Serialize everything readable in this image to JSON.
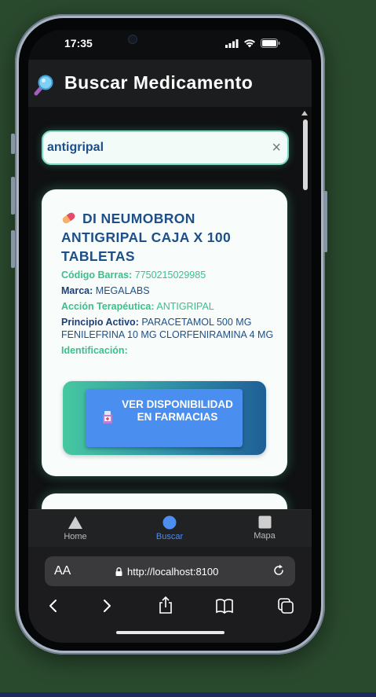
{
  "status_bar": {
    "time": "17:35"
  },
  "header": {
    "title": "Buscar Medicamento",
    "icon": "magnifier-icon"
  },
  "search": {
    "value": "antigripal",
    "clear_label": "×"
  },
  "result": {
    "title": "DI NEUMOBRON ANTIGRIPAL CAJA X 100 TABLETAS",
    "fields": [
      {
        "label": "Código Barras:",
        "value": "7750215029985"
      },
      {
        "label": "Marca:",
        "value": "MEGALABS"
      },
      {
        "label": "Acción Terapéutica:",
        "value": "ANTIGRIPAL"
      },
      {
        "label": "Principio Activo:",
        "value": "PARACETAMOL 500 MG FENILEFRINA 10 MG CLORFENIRAMINA 4 MG"
      },
      {
        "label": "Identificación:",
        "value": ""
      }
    ],
    "cta_label": "VER DISPONIBILIDAD EN FARMACIAS"
  },
  "tabs": [
    {
      "label": "Home",
      "icon": "triangle-icon"
    },
    {
      "label": "Buscar",
      "icon": "circle-icon",
      "active": true
    },
    {
      "label": "Mapa",
      "icon": "square-icon"
    }
  ],
  "browser": {
    "text_size_label": "AA",
    "url": "http://localhost:8100"
  },
  "colors": {
    "accent_blue": "#4a8ff0",
    "title_blue": "#1d4f8a",
    "label_green": "#3cbf8c"
  }
}
